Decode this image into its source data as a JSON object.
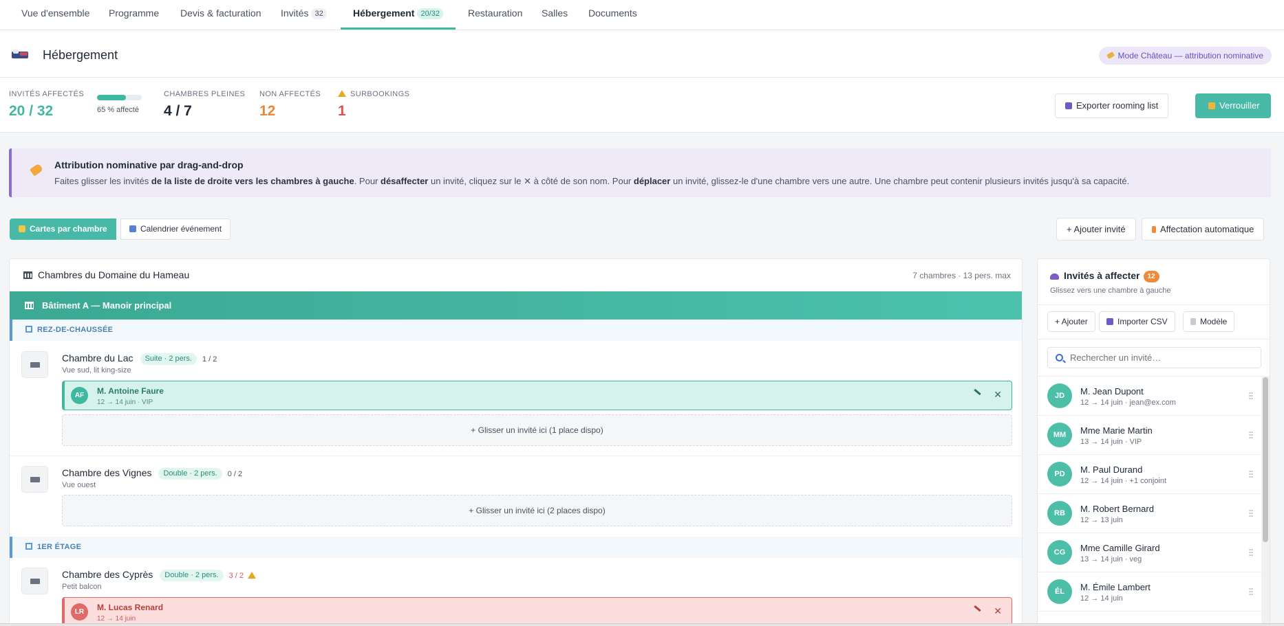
{
  "tabs": [
    {
      "label": "Vue d'ensemble"
    },
    {
      "label": "Programme"
    },
    {
      "label": "Devis & facturation"
    },
    {
      "label": "Invités",
      "badge": "32"
    },
    {
      "label": "Hébergement",
      "badge": "20/32",
      "active": true
    },
    {
      "label": "Restauration"
    },
    {
      "label": "Salles"
    },
    {
      "label": "Documents"
    }
  ],
  "header": {
    "title": "Hébergement",
    "mode_pill": "Mode Château — attribution nominative"
  },
  "stats": {
    "assigned_label": "INVITÉS AFFECTÉS",
    "assigned_value": "20 / 32",
    "progress_fraction": 0.65,
    "progress_text": "65 % affecté",
    "full_rooms_label": "CHAMBRES PLEINES",
    "full_rooms_value": "4 / 7",
    "unassigned_label": "NON AFFECTÉS",
    "unassigned_value": "12",
    "overbooking_label": "SURBOOKINGS",
    "overbooking_value": "1",
    "export_label": "Exporter rooming list",
    "lock_label": "Verrouiller"
  },
  "banner": {
    "title": "Attribution nominative par drag-and-drop",
    "t1": "Faites glisser les invités ",
    "b1": "de la liste de droite vers les chambres à gauche",
    "t2": ". Pour ",
    "b2": "désaffecter",
    "t3": " un invité, cliquez sur le ✕ à côté de son nom. Pour ",
    "b3": "déplacer",
    "t4": " un invité, glissez-le d'une chambre vers une autre. Une chambre peut contenir plusieurs invités jusqu'à sa capacité."
  },
  "view": {
    "cards_label": "Cartes par chambre",
    "calendar_label": "Calendrier événement",
    "add_guest_label": "+ Ajouter invité",
    "auto_assign_label": "Affectation automatique"
  },
  "rooms_panel": {
    "title": "Chambres du Domaine du Hameau",
    "meta": "7 chambres · 13 pers. max",
    "building": "Bâtiment A — Manoir principal",
    "floor_ground": "REZ-DE-CHAUSSÉE",
    "floor_first": "1ER ÉTAGE",
    "rooms": [
      {
        "name": "Chambre du Lac",
        "type": "Suite · 2 pers.",
        "count": "1 / 2",
        "sub": "Vue sud, lit king-size",
        "guest": {
          "initials": "AF",
          "name": "M. Antoine Faure",
          "info": "12 → 14 juin · VIP"
        },
        "drop": "+ Glisser un invité ici (1 place dispo)"
      },
      {
        "name": "Chambre des Vignes",
        "type": "Double · 2 pers.",
        "count": "0 / 2",
        "sub": "Vue ouest",
        "drop": "+ Glisser un invité ici (2 places dispo)"
      },
      {
        "name": "Chambre des Cyprès",
        "type": "Double · 2 pers.",
        "count": "3 / 2",
        "sub": "Petit balcon",
        "guest": {
          "initials": "LR",
          "name": "M. Lucas Renard",
          "info": "12 → 14 juin"
        }
      }
    ]
  },
  "guests_panel": {
    "title": "Invités à affecter",
    "count": "12",
    "subtitle": "Glissez vers une chambre à gauche",
    "add_label": "+ Ajouter",
    "import_label": "Importer CSV",
    "template_label": "Modèle",
    "search_placeholder": "Rechercher un invité…",
    "items": [
      {
        "initials": "JD",
        "name": "M. Jean Dupont",
        "info": "12 → 14 juin · jean@ex.com"
      },
      {
        "initials": "MM",
        "name": "Mme Marie Martin",
        "info": "13 → 14 juin · VIP"
      },
      {
        "initials": "PD",
        "name": "M. Paul Durand",
        "info": "12 → 14 juin · +1 conjoint"
      },
      {
        "initials": "RB",
        "name": "M. Robert Bernard",
        "info": "12 → 13 juin"
      },
      {
        "initials": "CG",
        "name": "Mme Camille Girard",
        "info": "13 → 14 juin · veg"
      },
      {
        "initials": "ÉL",
        "name": "M. Émile Lambert",
        "info": "12 → 14 juin"
      }
    ]
  },
  "colors": {
    "accent": "#47b9a6",
    "warning": "#e7873a",
    "danger": "#d9534f",
    "purple": "#8a6cd4"
  }
}
